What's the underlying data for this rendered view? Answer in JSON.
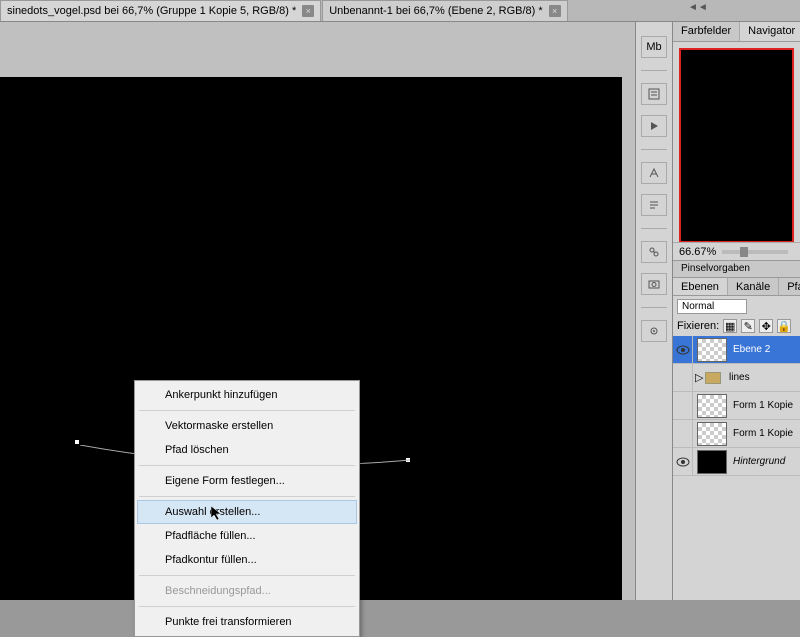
{
  "tabs": [
    {
      "label": "sinedots_vogel.psd bei 66,7% (Gruppe 1 Kopie 5, RGB/8) *",
      "active": true
    },
    {
      "label": "Unbenannt-1 bei 66,7% (Ebene 2, RGB/8) *",
      "active": false
    }
  ],
  "context_menu": {
    "items": [
      {
        "label": "Ankerpunkt hinzufügen",
        "type": "item"
      },
      {
        "type": "sep"
      },
      {
        "label": "Vektormaske erstellen",
        "type": "item"
      },
      {
        "label": "Pfad löschen",
        "type": "item"
      },
      {
        "type": "sep"
      },
      {
        "label": "Eigene Form festlegen...",
        "type": "item"
      },
      {
        "type": "sep"
      },
      {
        "label": "Auswahl erstellen...",
        "type": "item",
        "highlighted": true
      },
      {
        "label": "Pfadfläche füllen...",
        "type": "item"
      },
      {
        "label": "Pfadkontur füllen...",
        "type": "item"
      },
      {
        "type": "sep"
      },
      {
        "label": "Beschneidungspfad...",
        "type": "item",
        "disabled": true
      },
      {
        "type": "sep"
      },
      {
        "label": "Punkte frei transformieren",
        "type": "item"
      }
    ]
  },
  "right_panels": {
    "top_tabs": [
      "Farbfelder",
      "Navigator"
    ],
    "zoom_value": "66.67%",
    "brush_header": "Pinselvorgaben",
    "layer_tabs": [
      "Ebenen",
      "Kanäle",
      "Pfade"
    ],
    "blend_mode": "Normal",
    "lock_label": "Fixieren:",
    "layers": [
      {
        "name": "Ebene 2",
        "selected": true,
        "visible": true,
        "thumb": "checker"
      },
      {
        "name": "lines",
        "selected": false,
        "visible": false,
        "thumb": "folder"
      },
      {
        "name": "Form 1 Kopie",
        "selected": false,
        "visible": false,
        "thumb": "checker"
      },
      {
        "name": "Form 1 Kopie",
        "selected": false,
        "visible": false,
        "thumb": "checker"
      },
      {
        "name": "Hintergrund",
        "selected": false,
        "visible": true,
        "thumb": "black"
      }
    ]
  },
  "colors": {
    "selection_blue": "#3875d7",
    "canvas_bg": "#000000",
    "ui_grey": "#d4d4d4"
  }
}
